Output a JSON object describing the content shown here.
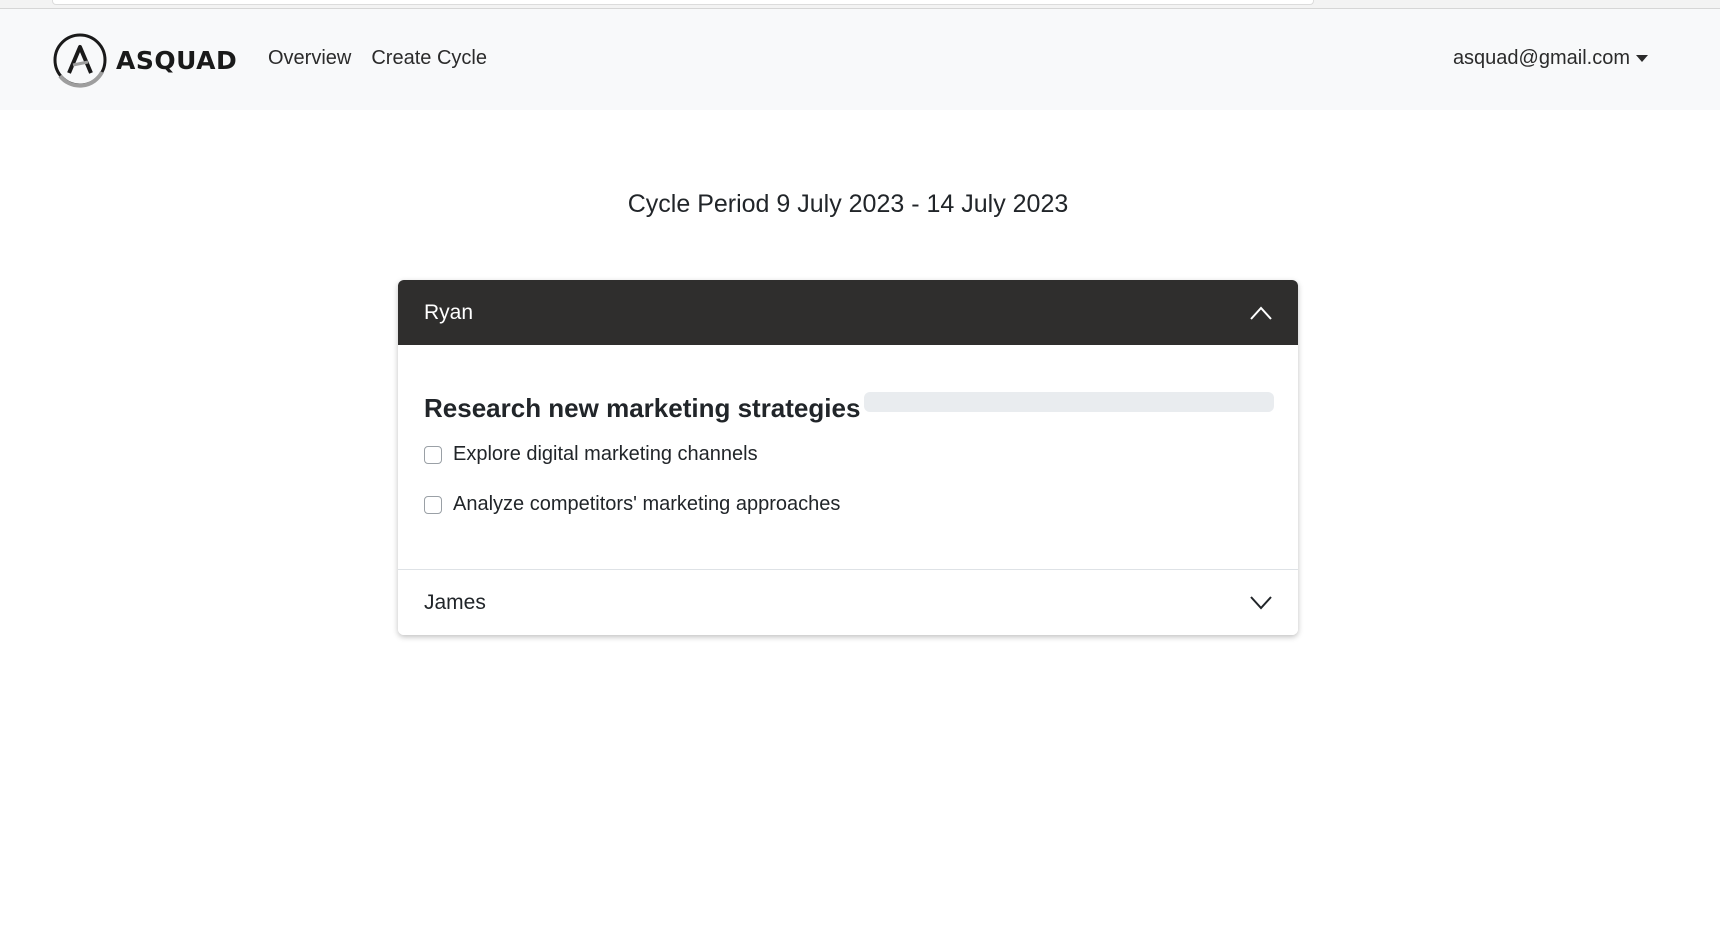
{
  "navbar": {
    "brand": "ASQUAD",
    "links": [
      "Overview",
      "Create Cycle"
    ],
    "user_email": "asquad@gmail.com"
  },
  "page": {
    "title": "Cycle Period 9 July 2023 - 14 July 2023"
  },
  "accordion": {
    "items": [
      {
        "name": "Ryan",
        "expanded": true,
        "goal": {
          "title": "Research new marketing strategies",
          "progress": 0,
          "tasks": [
            {
              "label": "Explore digital marketing channels",
              "checked": false
            },
            {
              "label": "Analyze competitors' marketing approaches",
              "checked": false
            }
          ]
        }
      },
      {
        "name": "James",
        "expanded": false
      }
    ]
  },
  "colors": {
    "navbar_bg": "#f8f9fa",
    "accordion_active_bg": "#2f2e2d",
    "progress_track": "#e9ecef"
  }
}
